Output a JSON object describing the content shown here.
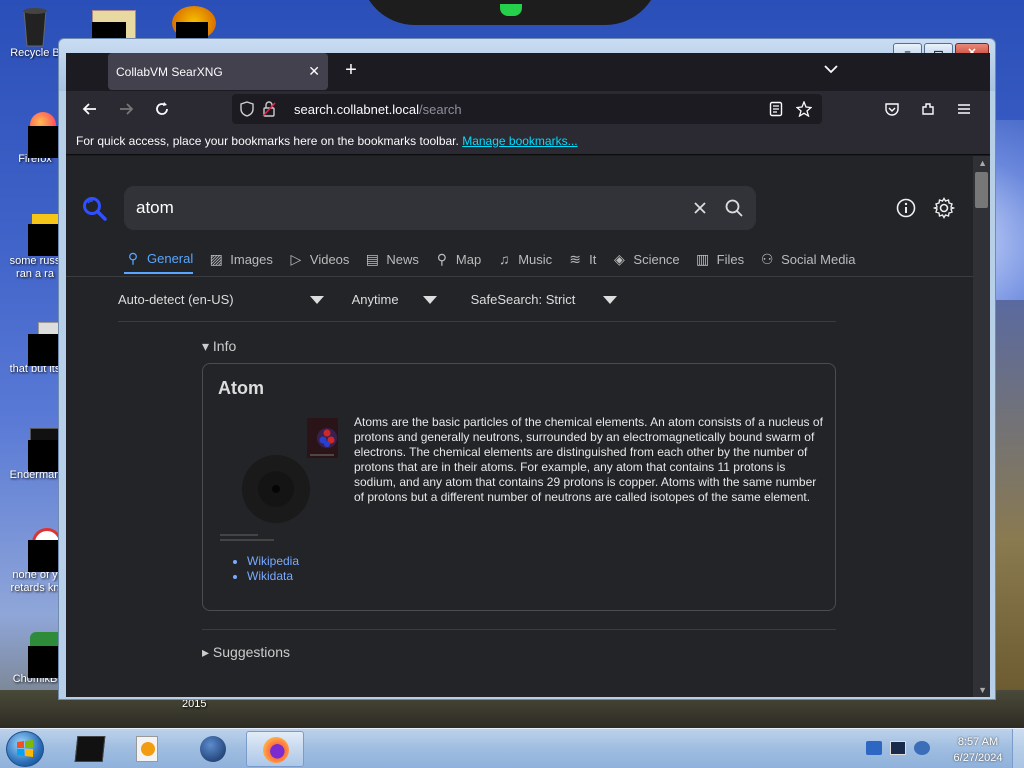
{
  "desktop": {
    "icons": [
      {
        "name": "recycle-bin",
        "label": "Recycle B"
      },
      {
        "name": "firefox",
        "label": "Firefox"
      },
      {
        "name": "file-3",
        "label": "some russ",
        "label2": "ran a ra"
      },
      {
        "name": "file-4",
        "label": "that but its"
      },
      {
        "name": "enderman",
        "label": "Enderman"
      },
      {
        "name": "file-6",
        "label": "none of y",
        "label2": "retards kn"
      },
      {
        "name": "chomik",
        "label": "ChomikB"
      }
    ],
    "partial_label": "2015"
  },
  "window": {
    "tab_title": "CollabVM SearXNG",
    "url_host": "search.collabnet.local",
    "url_path": "/search",
    "bookmarks_text": "For quick access, place your bookmarks here on the bookmarks toolbar.",
    "bookmarks_link": "Manage bookmarks..."
  },
  "search": {
    "query": "atom",
    "categories": [
      {
        "label": "General",
        "icon": "search-icon",
        "active": true
      },
      {
        "label": "Images",
        "icon": "image-icon"
      },
      {
        "label": "Videos",
        "icon": "play-icon"
      },
      {
        "label": "News",
        "icon": "news-icon"
      },
      {
        "label": "Map",
        "icon": "map-pin-icon"
      },
      {
        "label": "Music",
        "icon": "music-icon"
      },
      {
        "label": "It",
        "icon": "layers-icon"
      },
      {
        "label": "Science",
        "icon": "science-icon"
      },
      {
        "label": "Files",
        "icon": "files-icon"
      },
      {
        "label": "Social Media",
        "icon": "people-icon"
      }
    ],
    "filters": {
      "language": "Auto-detect (en-US)",
      "time": "Anytime",
      "safesearch": "SafeSearch: Strict"
    }
  },
  "infobox": {
    "toggle": "Info",
    "title": "Atom",
    "text": "Atoms are the basic particles of the chemical elements. An atom consists of a nucleus of protons and generally neutrons, surrounded by an electromagnetically bound swarm of electrons. The chemical elements are distinguished from each other by the number of protons that are in their atoms. For example, any atom that contains 11 protons is sodium, and any atom that contains 29 protons is copper. Atoms with the same number of protons but a different number of neutrons are called isotopes of the same element.",
    "links": [
      "Wikipedia",
      "Wikidata"
    ]
  },
  "suggestions": {
    "toggle": "Suggestions"
  },
  "taskbar": {
    "time": "8:57 AM",
    "date": "6/27/2024"
  },
  "colors": {
    "accent": "#58a6ff",
    "link": "#7aa9ff",
    "content_bg": "#222428"
  }
}
